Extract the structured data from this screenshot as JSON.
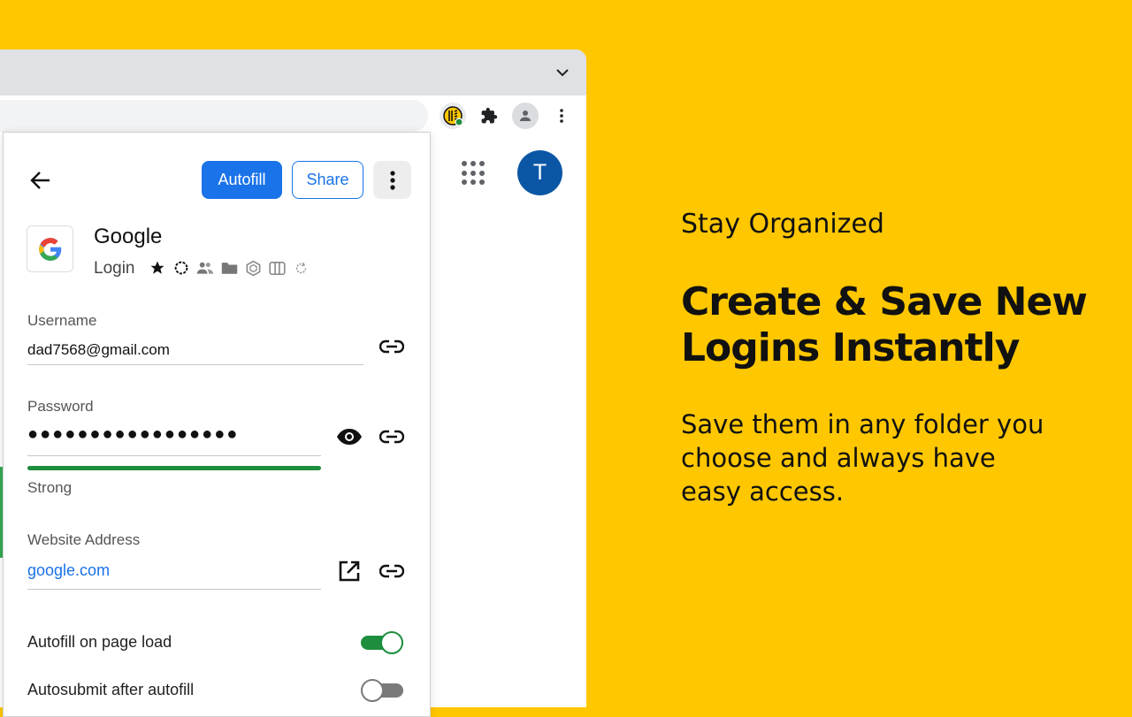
{
  "popup": {
    "autofill_button": "Autofill",
    "share_button": "Share",
    "record": {
      "title": "Google",
      "type": "Login",
      "meta_icons": [
        "star-icon",
        "spinner-circle-icon",
        "shared-users-icon",
        "folder-icon",
        "hexagon-icon",
        "columns-icon",
        "refresh-icon"
      ]
    },
    "username": {
      "label": "Username",
      "value": "dad7568@gmail.com"
    },
    "password": {
      "label": "Password",
      "masked_value": "●●●●●●●●●●●●●●●●●",
      "strength_label": "Strong",
      "strength_fraction": 1.0,
      "strength_color": "#1E8E3E"
    },
    "website": {
      "label": "Website Address",
      "value": "google.com"
    },
    "toggles": [
      {
        "label": "Autofill on page load",
        "on": true
      },
      {
        "label": "Autosubmit after autofill",
        "on": false
      }
    ]
  },
  "page": {
    "avatar_initial": "T"
  },
  "marketing": {
    "eyebrow": "Stay Organized",
    "headline": "Create & Save New Logins Instantly",
    "body": "Save them in any folder you choose and always have easy access."
  },
  "colors": {
    "background": "#FFC700",
    "accent": "#1A73E8",
    "toggle_on": "#1E8E3E",
    "avatar": "#0B57A5"
  }
}
